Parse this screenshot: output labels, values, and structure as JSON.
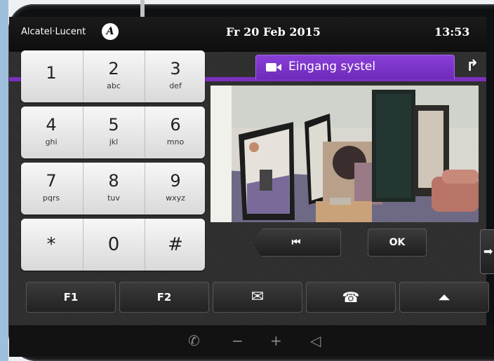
{
  "header": {
    "brand": "Alcatel·Lucent",
    "brand_logo_letter": "A",
    "date": "Fr 20 Feb 2015",
    "time": "13:53"
  },
  "tab": {
    "label": "Eingang systel",
    "icon": "video-camera-icon",
    "accent_color": "#7b2fbf"
  },
  "transfer": {
    "icon": "call-transfer-icon",
    "glyph": "↱"
  },
  "keypad": [
    {
      "digit": "1",
      "sub": ""
    },
    {
      "digit": "2",
      "sub": "abc"
    },
    {
      "digit": "3",
      "sub": "def"
    },
    {
      "digit": "4",
      "sub": "ghi"
    },
    {
      "digit": "5",
      "sub": "jkl"
    },
    {
      "digit": "6",
      "sub": "mno"
    },
    {
      "digit": "7",
      "sub": "pqrs"
    },
    {
      "digit": "8",
      "sub": "tuv"
    },
    {
      "digit": "9",
      "sub": "wxyz"
    },
    {
      "digit": "*",
      "sub": ""
    },
    {
      "digit": "0",
      "sub": ""
    },
    {
      "digit": "#",
      "sub": ""
    }
  ],
  "controls": {
    "prev_glyph": "⏮",
    "ok_label": "OK",
    "side_arrow_glyph": "➡"
  },
  "function_keys": {
    "f1": "F1",
    "f2": "F2",
    "mail_glyph": "✉",
    "hangup_glyph": "☎",
    "up_glyph": "⏶"
  },
  "bottom_bar": {
    "handset_glyph": "✆",
    "minus": "−",
    "plus": "+",
    "speaker_glyph": "◁"
  }
}
